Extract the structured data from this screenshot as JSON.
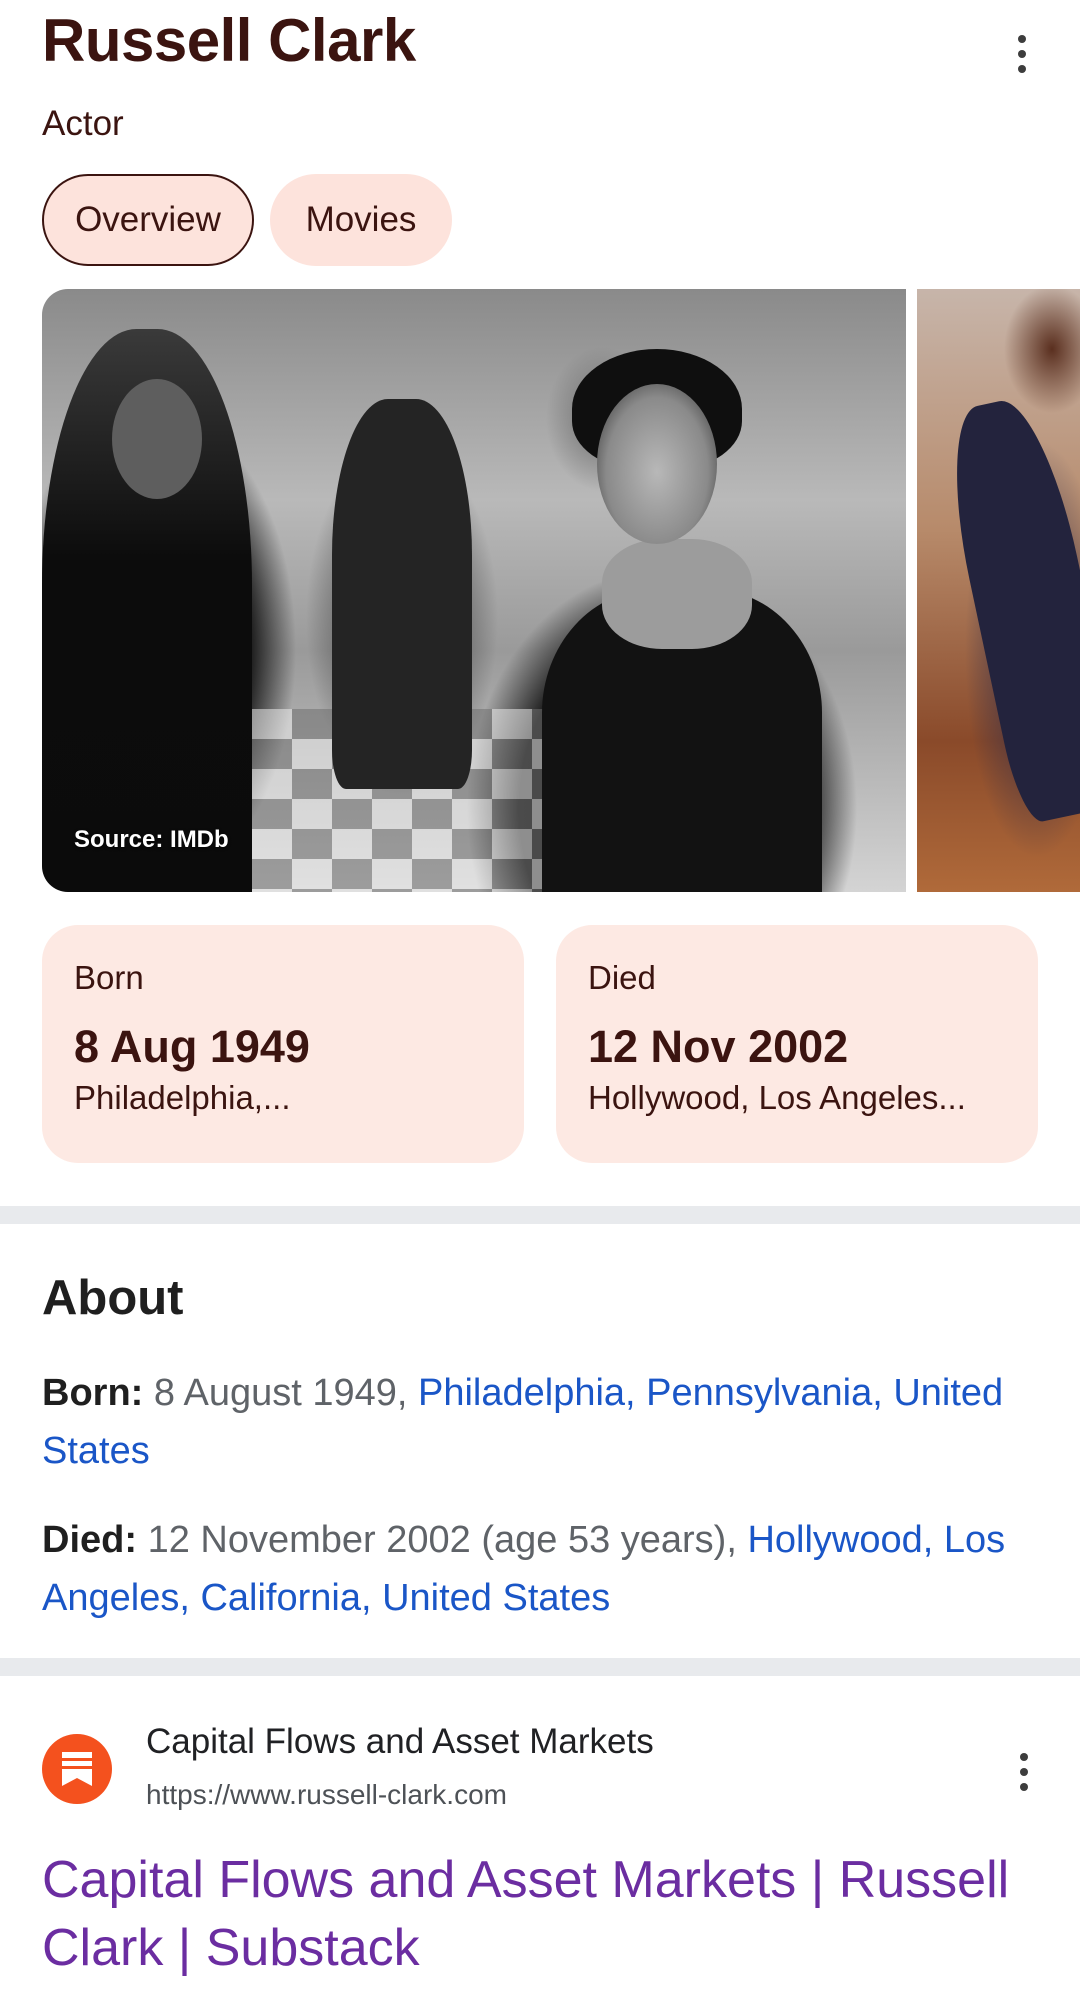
{
  "header": {
    "title": "Russell Clark",
    "subtitle": "Actor"
  },
  "tabs": [
    {
      "label": "Overview",
      "active": true
    },
    {
      "label": "Movies",
      "active": false
    }
  ],
  "images": {
    "main_source": "Source: IMDb"
  },
  "cards": {
    "born": {
      "label": "Born",
      "date": "8 Aug 1949",
      "place": "Philadelphia,..."
    },
    "died": {
      "label": "Died",
      "date": "12 Nov 2002",
      "place": "Hollywood, Los Angeles..."
    }
  },
  "about": {
    "heading": "About",
    "born": {
      "label": "Born:",
      "text": "8 August 1949,",
      "link": "Philadelphia, Pennsylvania, United States"
    },
    "died": {
      "label": "Died:",
      "text": "12 November 2002 (age 53 years),",
      "link": "Hollywood, Los Angeles, California, United States"
    }
  },
  "result": {
    "site_name": "Capital Flows and Asset Markets",
    "url": "https://www.russell-clark.com",
    "title": "Capital Flows and Asset Markets | Russell Clark | Substack"
  },
  "colors": {
    "accent_text": "#3b1410",
    "chip_bg": "#fde3dc",
    "link": "#1a56c7",
    "visited_link": "#6b2da1",
    "favicon": "#f4511e"
  }
}
